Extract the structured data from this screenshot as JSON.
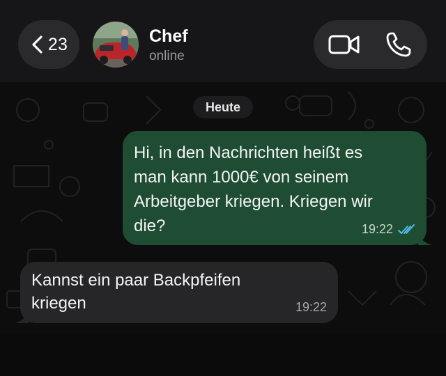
{
  "header": {
    "back_count": "23",
    "contact_name": "Chef",
    "contact_status": "online",
    "icons": [
      "chevron-left-icon",
      "video-call-icon",
      "phone-icon"
    ]
  },
  "chat": {
    "date_label": "Heute",
    "messages": [
      {
        "direction": "outgoing",
        "text": "Hi, in den Nachrichten heißt es\nman kann 1000€ von seinem\nArbeitgeber kriegen. Kriegen wir\ndie?",
        "time": "19:22",
        "status": "read"
      },
      {
        "direction": "incoming",
        "text": "Kannst ein paar Backpfeifen\nkriegen",
        "time": "19:22"
      }
    ]
  },
  "colors": {
    "outgoing_bubble": "#1f4d33",
    "incoming_bubble": "#262628",
    "read_ticks": "#53bdeb"
  }
}
